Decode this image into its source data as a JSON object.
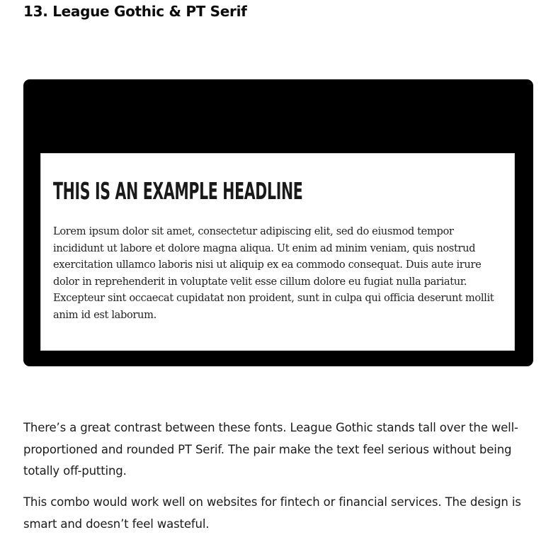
{
  "article": {
    "section_heading": "13. League Gothic & PT Serif",
    "example": {
      "headline": "THIS IS AN EXAMPLE HEADLINE",
      "body": "Lorem ipsum dolor sit amet, consectetur adipiscing elit, sed do eiusmod tempor incididunt ut labore et dolore magna aliqua. Ut enim ad minim veniam, quis nostrud exercitation ullamco laboris nisi ut aliquip ex ea commodo consequat. Duis aute irure dolor in reprehenderit in voluptate velit esse cillum dolore eu fugiat nulla pariatur. Excepteur sint occaecat cupidatat non proident, sunt in culpa qui officia deserunt mollit anim id est laborum."
    },
    "paragraphs": [
      "There’s a great contrast between these fonts. League Gothic stands tall over the well-proportioned and rounded PT Serif. The pair make the text feel serious without being totally off-putting.",
      "This combo would work well on websites for fintech or financial services. The design is smart and doesn’t feel wasteful."
    ]
  },
  "colors": {
    "card_background": "#000000",
    "sheet_background": "#ffffff",
    "text": "#1b1b1b"
  }
}
